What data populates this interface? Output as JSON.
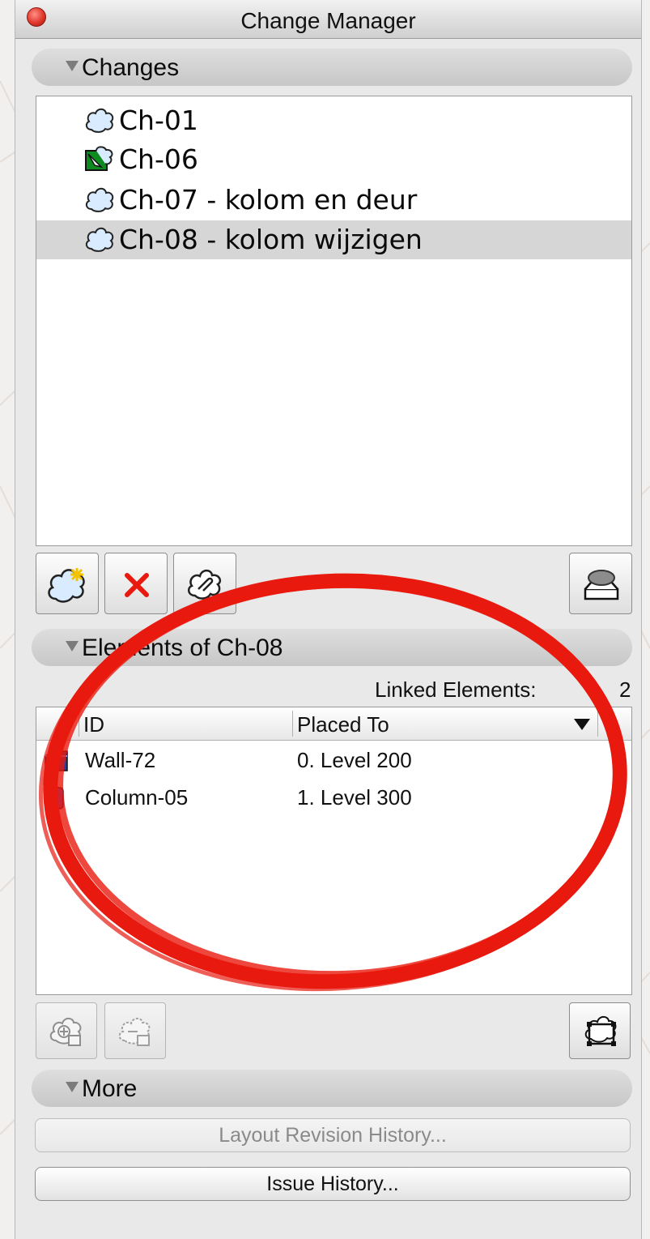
{
  "window": {
    "title": "Change Manager"
  },
  "changes_section": {
    "header": "Changes",
    "items": [
      {
        "label": "Ch-01",
        "icon": "cloud-icon",
        "selected": false
      },
      {
        "label": "Ch-06",
        "icon": "change-marker-icon",
        "selected": false
      },
      {
        "label": "Ch-07 - kolom en deur",
        "icon": "cloud-icon",
        "selected": false
      },
      {
        "label": "Ch-08 - kolom wijzigen",
        "icon": "cloud-icon",
        "selected": true
      }
    ],
    "toolbar": {
      "new_icon": "new-change-icon",
      "delete_icon": "delete-icon",
      "link_icon": "link-change-icon",
      "layout_icon": "layer-stack-icon"
    }
  },
  "elements_section": {
    "header": "Elements of Ch-08",
    "linked_label": "Linked Elements:",
    "linked_count": "2",
    "columns": {
      "id": "ID",
      "placed_to": "Placed To"
    },
    "rows": [
      {
        "id": "Wall-72",
        "placed_to": "0. Level 200",
        "icon": "wall-icon"
      },
      {
        "id": "Column-05",
        "placed_to": "1. Level 300",
        "icon": "column-icon"
      }
    ],
    "toolbar": {
      "add_icon": "add-element-icon",
      "remove_icon": "remove-element-icon",
      "select_icon": "select-elements-icon"
    }
  },
  "more_section": {
    "header": "More",
    "layout_revision_button": "Layout Revision History...",
    "issue_history_button": "Issue History..."
  },
  "colors": {
    "selection": "#d6d6d6",
    "annotation": "#e8190e",
    "close_button": "#e0372b"
  }
}
